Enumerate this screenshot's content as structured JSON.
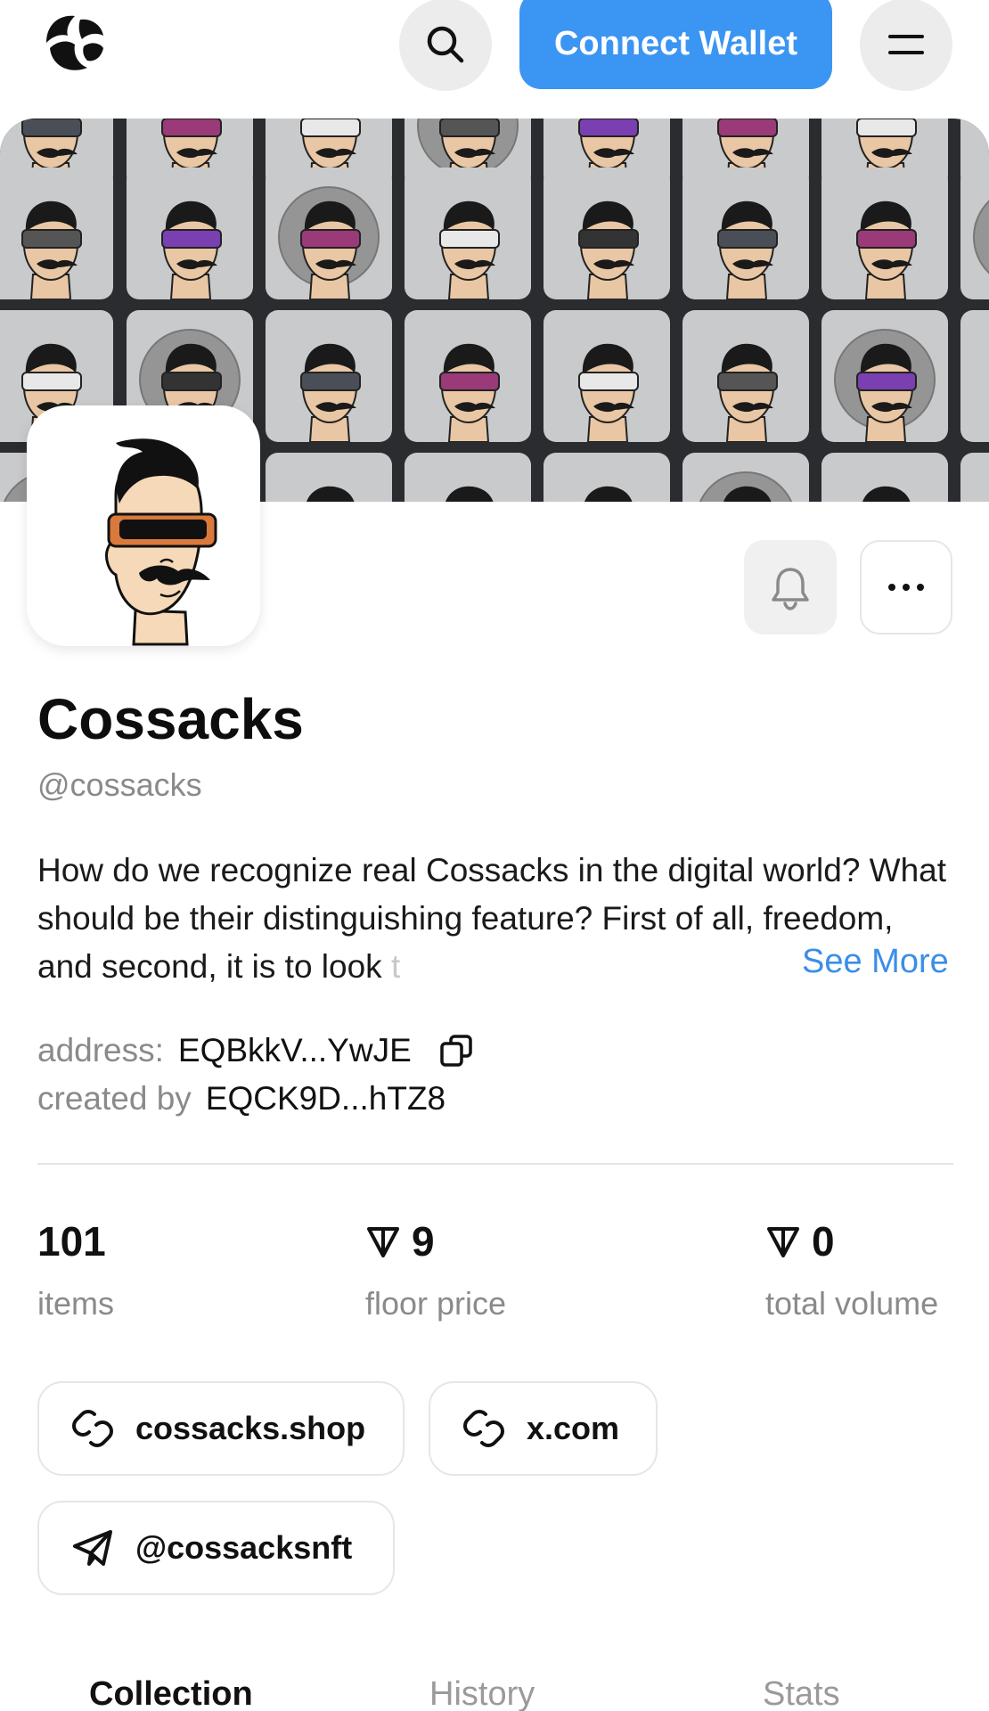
{
  "header": {
    "connect_label": "Connect Wallet"
  },
  "collection": {
    "name": "Cossacks",
    "handle": "@cossacks",
    "description": "How do we recognize real Cossacks in the digital world? What should be their distinguishing feature? First of all, freedom, and second, it is to look",
    "description_fade": " t",
    "see_more": "See More",
    "address_label": "address:",
    "address_value": "EQBkkV...YwJE",
    "created_label": "created by",
    "created_value": "EQCK9D...hTZ8"
  },
  "stats": {
    "items_value": "101",
    "items_label": "items",
    "floor_value": "9",
    "floor_label": "floor price",
    "volume_value": "0",
    "volume_label": "total volume"
  },
  "links": [
    {
      "label": "cossacks.shop",
      "icon": "link-icon"
    },
    {
      "label": "x.com",
      "icon": "link-icon"
    },
    {
      "label": "@cossacksnft",
      "icon": "telegram-icon"
    }
  ],
  "tabs": [
    {
      "label": "Collection",
      "active": true
    },
    {
      "label": "History",
      "active": false
    },
    {
      "label": "Stats",
      "active": false
    }
  ],
  "colors": {
    "accent": "#3b95f2",
    "muted": "#8a8a8a",
    "banner_bg": "#2b2c30",
    "tile_bg": "#c9cacb"
  }
}
